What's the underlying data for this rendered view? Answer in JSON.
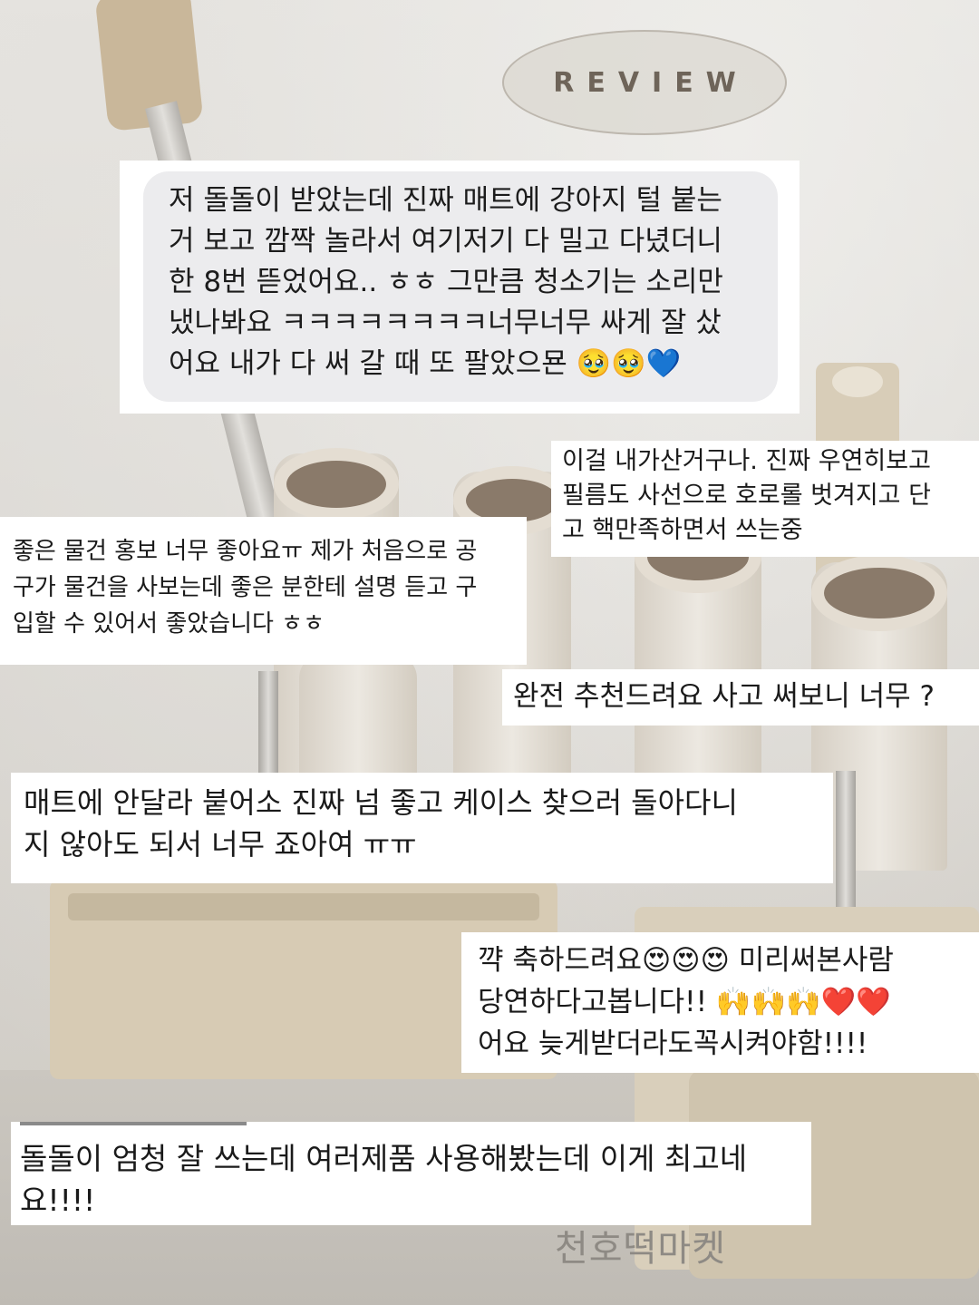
{
  "header": {
    "badge_label": "REVIEW"
  },
  "reviews": [
    {
      "text": "저 돌돌이 받았는데 진짜 매트에 강아지 털 붙는\n거 보고 깜짝 놀라서 여기저기 다 밀고 다녔더니\n한 8번 뜯었어요.. ㅎㅎ 그만큼 청소기는 소리만\n냈나봐요 ㅋㅋㅋㅋㅋㅋㅋㅋ너무너무 싸게 잘 샀\n어요 내가 다 써 갈 때 또 팔았으묜 🥹🥹💙"
    },
    {
      "text": "이걸 내가산거구나. 진짜 우연히보고\n필름도 사선으로 호로롤 벗겨지고 단\n고 핵만족하면서 쓰는중"
    },
    {
      "text": "좋은 물건 홍보 너무 좋아요ㅠ 제가 처음으로 공\n구가 물건을 사보는데 좋은 분한테 설명 듣고 구\n입할 수 있어서 좋았습니다 ㅎㅎ"
    },
    {
      "text": "완전 추천드려요 사고 써보니 너무 ?"
    },
    {
      "text": "매트에 안달라 붙어소 진짜 넘 좋고 케이스 찾으러 돌아다니\n지 않아도 되서 너무 죠아여 ㅠㅠ"
    },
    {
      "text": "꺅 축하드려요😍😍😍 미리써본사람\n당연하다고봅니다!! 🙌🙌🙌❤️❤️\n어요 늦게받더라도꼭시켜야함!!!!"
    },
    {
      "text": "돌돌이 엄청 잘 쓰는데 여러제품 사용해봤는데 이게 최고네\n요!!!!"
    }
  ],
  "watermark": "천호떡마켓"
}
